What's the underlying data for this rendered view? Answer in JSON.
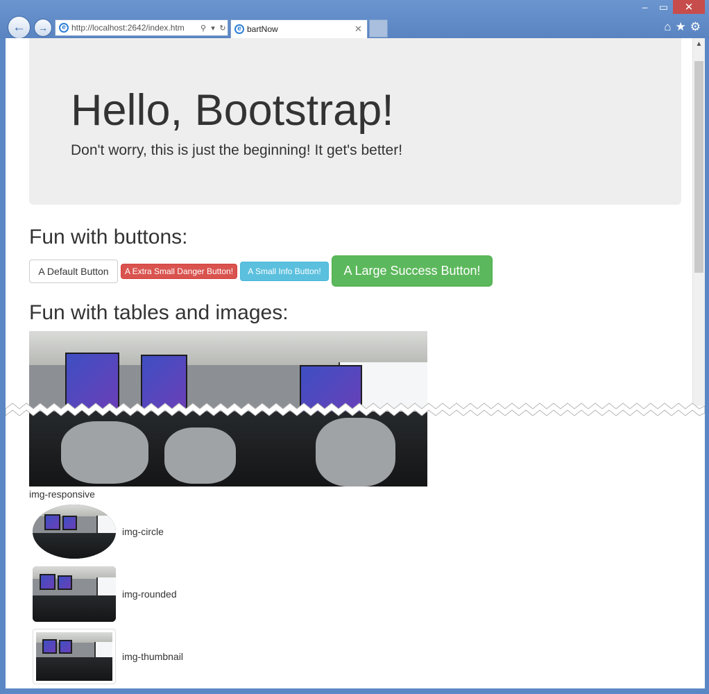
{
  "browser": {
    "address_url": "http://localhost:2642/index.htm",
    "tab_title": "bartNow",
    "window_buttons": {
      "minimize": "–",
      "maximize": "▭",
      "close": "✕"
    }
  },
  "page": {
    "jumbotron": {
      "title": "Hello, Bootstrap!",
      "subtitle": "Don't worry, this is just the beginning! It get's better!"
    },
    "buttons_heading": "Fun with buttons:",
    "buttons": {
      "default": "A Default Button",
      "danger": "A Extra Small Danger Button!",
      "info": "A Small Info Button!",
      "success": "A Large Success Button!"
    },
    "tables_heading": "Fun with tables and images:",
    "image_captions": {
      "responsive": "img-responsive",
      "circle": "img-circle",
      "rounded": "img-rounded",
      "thumbnail": "img-thumbnail"
    }
  },
  "colors": {
    "chrome": "#5b87c4",
    "jumbotron_bg": "#eeeeee",
    "danger": "#d9534f",
    "info": "#5bc0de",
    "success": "#5cb85c"
  },
  "icons": [
    "back-arrow-icon",
    "forward-arrow-icon",
    "ie-logo-icon",
    "search-icon",
    "refresh-icon",
    "home-icon",
    "favorites-star-icon",
    "settings-gear-icon",
    "scroll-up-arrow-icon"
  ]
}
